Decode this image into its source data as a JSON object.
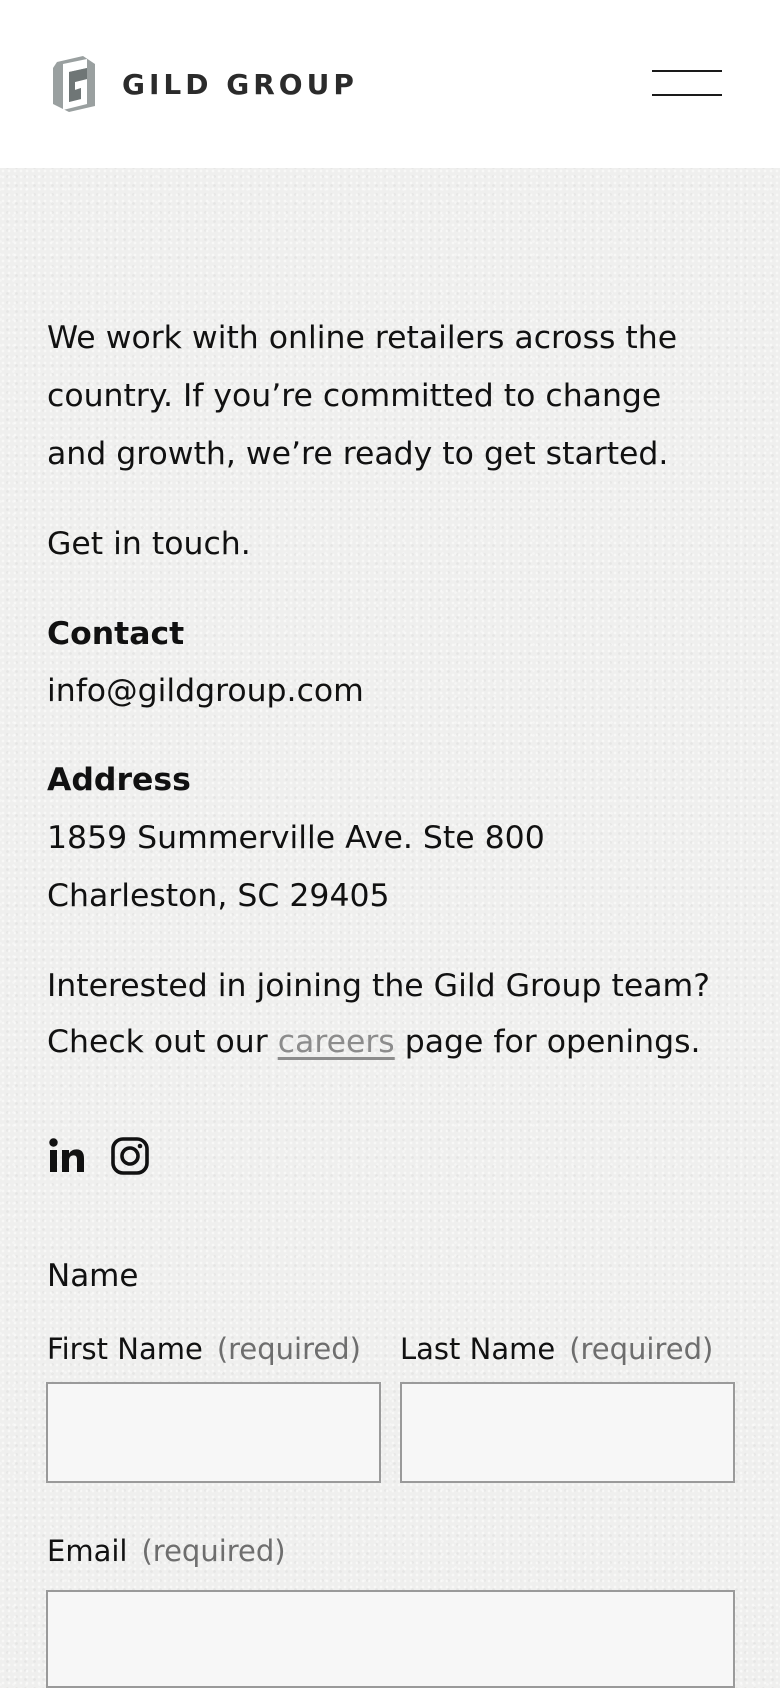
{
  "header": {
    "brand": "GILD GROUP",
    "logo_icon": "gild-group-logo-mark",
    "menu_icon": "hamburger-menu-icon"
  },
  "intro": {
    "line1": "We work with online retailers across the",
    "line2": "country. If you’re committed to change",
    "line3": "and growth, we’re ready to get started."
  },
  "cta": "Get in touch.",
  "contact": {
    "heading": "Contact",
    "email": "info@gildgroup.com"
  },
  "address": {
    "heading": "Address",
    "line1": "1859 Summerville Ave. Ste 800",
    "line2": "Charleston, SC 29405"
  },
  "careers": {
    "line1": "Interested in joining the Gild Group team?",
    "line2_before": "Check out our ",
    "link": "careers",
    "line2_after": " page for openings."
  },
  "social": {
    "linkedin_icon": "linkedin-icon",
    "instagram_icon": "instagram-icon"
  },
  "form": {
    "name_label": "Name",
    "first_name_label": "First Name",
    "last_name_label": "Last Name",
    "email_label": "Email",
    "required_text": "(required)",
    "first_name_value": "",
    "last_name_value": "",
    "email_value": ""
  },
  "colors": {
    "header_bg": "#ffffff",
    "page_bg": "#efefee",
    "text": "#111111",
    "link": "#8c8c8c",
    "required": "#6e6e6e",
    "input_border": "#9a9a9a"
  }
}
